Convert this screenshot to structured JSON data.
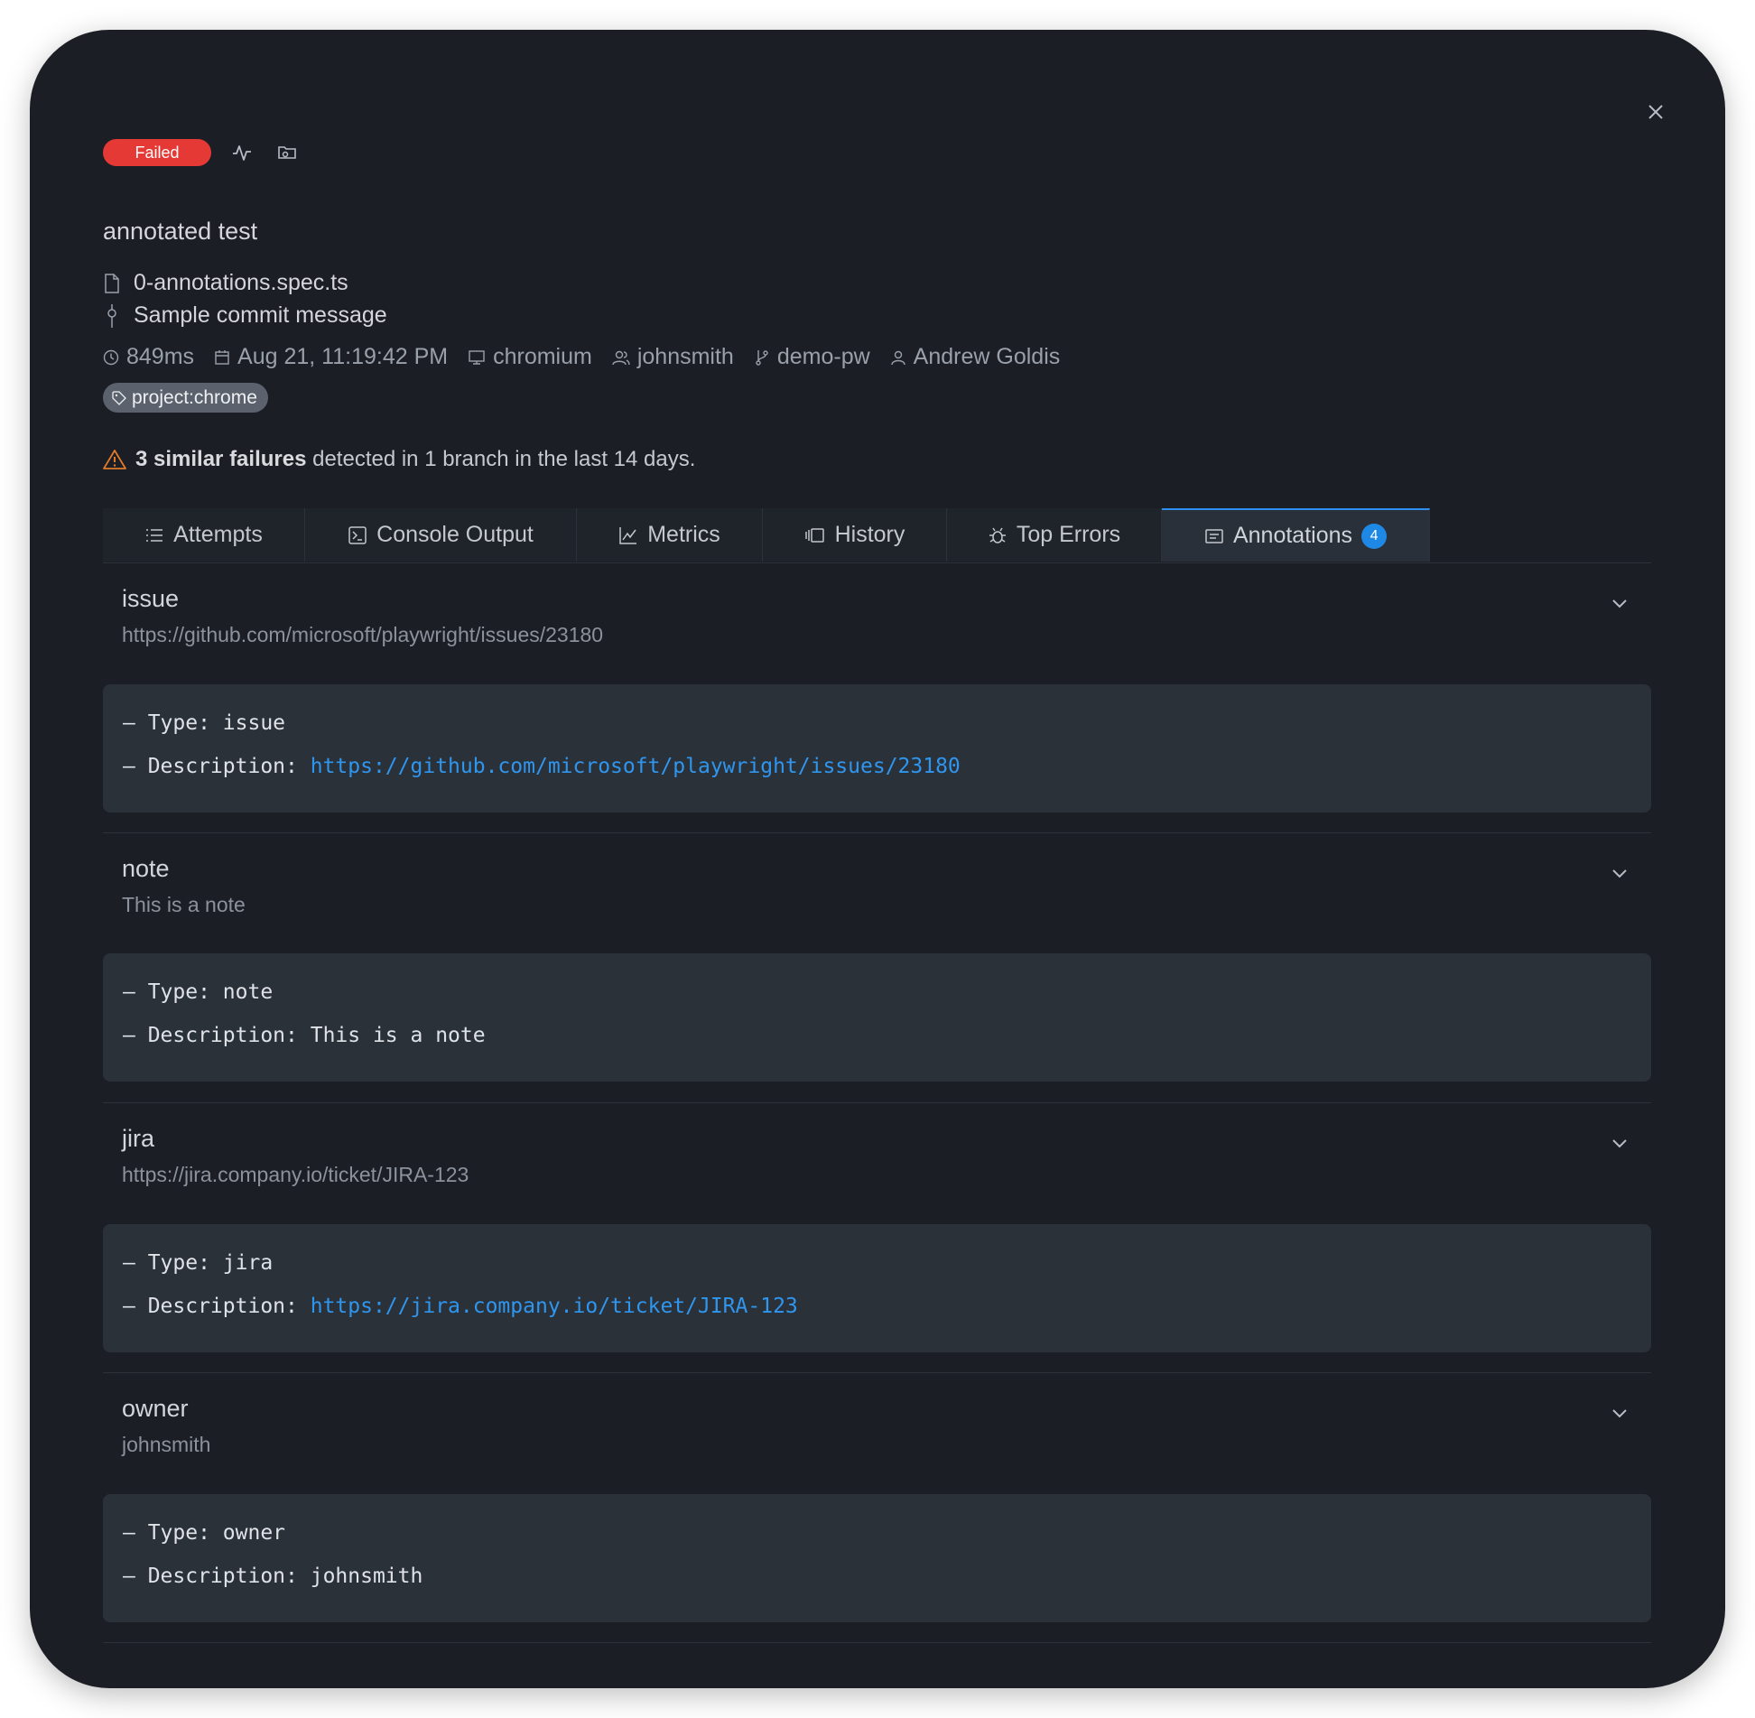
{
  "status": {
    "label": "Failed",
    "color": "#e53935"
  },
  "test": {
    "title": "annotated test",
    "file": "0-annotations.spec.ts",
    "commit": "Sample commit message"
  },
  "meta": {
    "duration": "849ms",
    "date": "Aug 21, 11:19:42 PM",
    "browser": "chromium",
    "user": "johnsmith",
    "branch": "demo-pw",
    "author": "Andrew Goldis"
  },
  "tag": "project:chrome",
  "warning": {
    "bold": "3 similar failures",
    "rest": " detected in 1 branch in the last 14 days."
  },
  "tabs": [
    {
      "label": "Attempts",
      "icon": "list-icon"
    },
    {
      "label": "Console Output",
      "icon": "terminal-icon"
    },
    {
      "label": "Metrics",
      "icon": "chart-icon"
    },
    {
      "label": "History",
      "icon": "history-icon"
    },
    {
      "label": "Top Errors",
      "icon": "bug-icon"
    },
    {
      "label": "Annotations",
      "icon": "annotation-icon",
      "count": "4",
      "active": true
    }
  ],
  "annotations": [
    {
      "name": "issue",
      "summary": "https://github.com/microsoft/playwright/issues/23180",
      "type_prefix": "– Type: ",
      "type": "issue",
      "desc_prefix": "– Description: ",
      "desc": "https://github.com/microsoft/playwright/issues/23180",
      "desc_is_link": true
    },
    {
      "name": "note",
      "summary": "This is a note",
      "type_prefix": "– Type: ",
      "type": "note",
      "desc_prefix": "– Description: ",
      "desc": "This is a note",
      "desc_is_link": false
    },
    {
      "name": "jira",
      "summary": "https://jira.company.io/ticket/JIRA-123",
      "type_prefix": "– Type: ",
      "type": "jira",
      "desc_prefix": "– Description: ",
      "desc": "https://jira.company.io/ticket/JIRA-123",
      "desc_is_link": true
    },
    {
      "name": "owner",
      "summary": "johnsmith",
      "type_prefix": "– Type: ",
      "type": "owner",
      "desc_prefix": "– Description: ",
      "desc": "johnsmith",
      "desc_is_link": false
    }
  ],
  "colors": {
    "accent": "#2f8ff0",
    "link": "#2f96ef",
    "warning": "#e07b2a"
  }
}
